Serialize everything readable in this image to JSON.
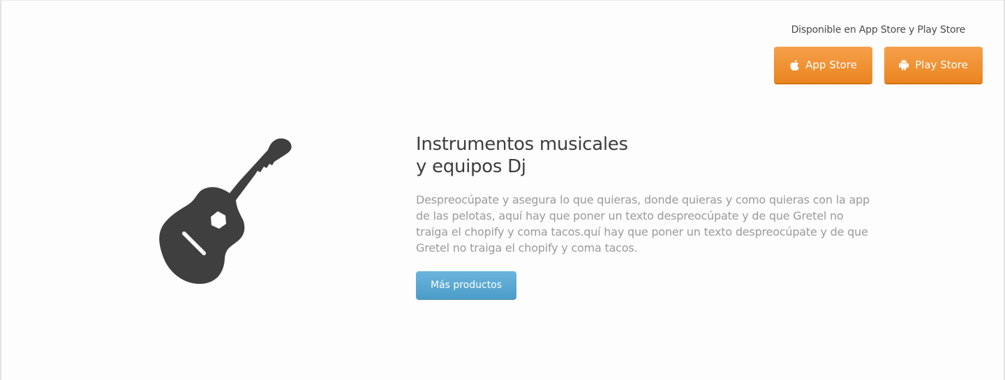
{
  "stores": {
    "caption": "Disponible en App Store y Play Store",
    "app_store": {
      "label": "App Store",
      "icon": "apple-icon"
    },
    "play_store": {
      "label": "Play Store",
      "icon": "android-icon"
    },
    "accent_color": "#f0922f"
  },
  "hero": {
    "icon": "guitar-icon",
    "title": "Instrumentos musicales y equipos Dj",
    "description": "Despreocúpate y asegura lo que quieras, donde quieras y como quieras con la app de las pelotas, aquí hay que poner un texto despreocúpate y de que Gretel no traiga el chopify y coma tacos.quí hay que poner un texto despreocúpate y de que Gretel no traiga el chopify y coma tacos.",
    "button_label": "Más productos",
    "button_color": "#5aa8d4"
  }
}
